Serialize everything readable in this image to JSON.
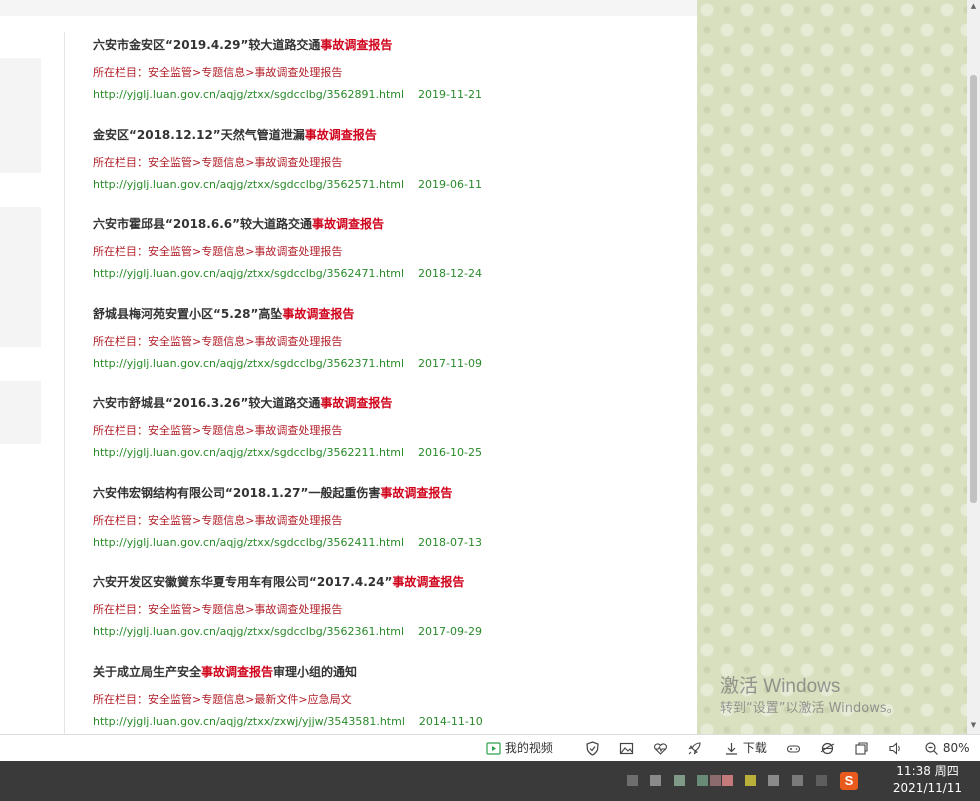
{
  "results": [
    {
      "title_pre": "六安市金安区“2019.4.29”较大道路交通",
      "title_hl": "事故调查报告",
      "title_post": "",
      "path": "所在栏目：安全监管>专题信息>事故调查处理报告",
      "url": "http://yjglj.luan.gov.cn/aqjg/ztxx/sgdcclbg/3562891.html",
      "date": "2019-11-21"
    },
    {
      "title_pre": "金安区“2018.12.12”天然气管道泄漏",
      "title_hl": "事故调查报告",
      "title_post": "",
      "path": "所在栏目：安全监管>专题信息>事故调查处理报告",
      "url": "http://yjglj.luan.gov.cn/aqjg/ztxx/sgdcclbg/3562571.html",
      "date": "2019-06-11"
    },
    {
      "title_pre": "六安市霍邱县“2018.6.6”较大道路交通",
      "title_hl": "事故调查报告",
      "title_post": "",
      "path": "所在栏目：安全监管>专题信息>事故调查处理报告",
      "url": "http://yjglj.luan.gov.cn/aqjg/ztxx/sgdcclbg/3562471.html",
      "date": "2018-12-24"
    },
    {
      "title_pre": "舒城县梅河苑安置小区“5.28”高坠",
      "title_hl": "事故调查报告",
      "title_post": "",
      "path": "所在栏目：安全监管>专题信息>事故调查处理报告",
      "url": "http://yjglj.luan.gov.cn/aqjg/ztxx/sgdcclbg/3562371.html",
      "date": "2017-11-09"
    },
    {
      "title_pre": "六安市舒城县“2016.3.26”较大道路交通",
      "title_hl": "事故调查报告",
      "title_post": "",
      "path": "所在栏目：安全监管>专题信息>事故调查处理报告",
      "url": "http://yjglj.luan.gov.cn/aqjg/ztxx/sgdcclbg/3562211.html",
      "date": "2016-10-25"
    },
    {
      "title_pre": "六安伟宏钢结构有限公司“2018.1.27”一般起重伤害",
      "title_hl": "事故调查报告",
      "title_post": "",
      "path": "所在栏目：安全监管>专题信息>事故调查处理报告",
      "url": "http://yjglj.luan.gov.cn/aqjg/ztxx/sgdcclbg/3562411.html",
      "date": "2018-07-13"
    },
    {
      "title_pre": "六安开发区安徽黉东华夏专用车有限公司“2017.4.24”",
      "title_hl": "事故调查报告",
      "title_post": "",
      "path": "所在栏目：安全监管>专题信息>事故调查处理报告",
      "url": "http://yjglj.luan.gov.cn/aqjg/ztxx/sgdcclbg/3562361.html",
      "date": "2017-09-29"
    },
    {
      "title_pre": "关于成立局生产安全",
      "title_hl": "事故调查报告",
      "title_post": "审理小组的通知",
      "path": "所在栏目：安全监管>专题信息>最新文件>应急局文",
      "url": "http://yjglj.luan.gov.cn/aqjg/ztxx/zxwj/yjjw/3543581.html",
      "date": "2014-11-10"
    }
  ],
  "watermark": {
    "title": "激活 Windows",
    "subtitle": "转到“设置”以激活 Windows。"
  },
  "status_bar": {
    "my_video": "我的视频",
    "download": "下载",
    "zoom": "80%"
  },
  "taskbar": {
    "time": "11:38 周四",
    "date": "2021/11/11",
    "ime_label": "S"
  },
  "colors": {
    "highlight": "#d0021b",
    "path": "#b3202a",
    "url": "#2a8a2a",
    "panel": "#d9e0c0"
  }
}
